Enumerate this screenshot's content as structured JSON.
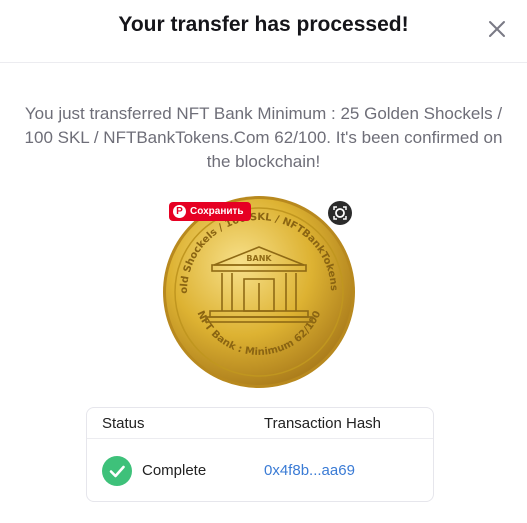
{
  "header": {
    "title": "Your transfer has processed!",
    "close_icon": "close-icon"
  },
  "message": "You just transferred NFT Bank Minimum : 25 Golden Shockels / 100 SKL / NFTBankTokens.Com 62/100. It's been confirmed on the blockchain!",
  "coin": {
    "top_text": "25 Gold Shockels / 100 SKL / NFTBankTokens.Com",
    "bottom_text": "NFT Bank : Minimum   62/100",
    "building_text": "BANK",
    "colors": {
      "gold_light": "#f2d46a",
      "gold": "#d9ad2c",
      "gold_dark": "#a27817"
    }
  },
  "overlay": {
    "pin_label": "Сохранить",
    "pin_icon": "pinterest-icon",
    "lens_icon": "lens-search-icon"
  },
  "table": {
    "headers": {
      "status": "Status",
      "hash": "Transaction Hash"
    },
    "row": {
      "status": "Complete",
      "hash": "0x4f8b...aa69",
      "status_icon": "check-circle-icon"
    }
  },
  "colors": {
    "success": "#3ec17a",
    "link": "#3a7bd5",
    "pinterest": "#e60023"
  }
}
